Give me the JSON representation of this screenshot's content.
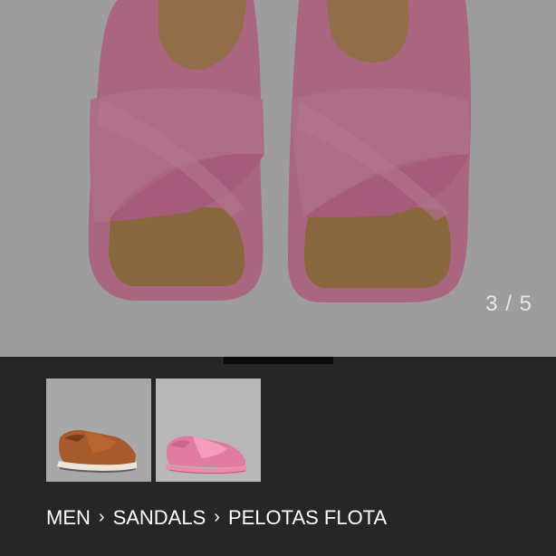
{
  "gallery": {
    "counter": "3 / 5",
    "current_index": 3,
    "total": 5,
    "progress_fraction": 0.6,
    "thumbnails": [
      {
        "name": "brown-sandal-side-view",
        "color": "#a75a2b"
      },
      {
        "name": "pink-sandal-side-view",
        "color": "#d97597"
      }
    ]
  },
  "breadcrumb": {
    "items": [
      "MEN",
      "SANDALS",
      "PELOTAS FLOTA"
    ],
    "separator": "›"
  },
  "colors": {
    "page_background": "#262626",
    "sandal_pink": "#ec8eb3",
    "cork": "#b98c57",
    "text": "#ffffff"
  }
}
